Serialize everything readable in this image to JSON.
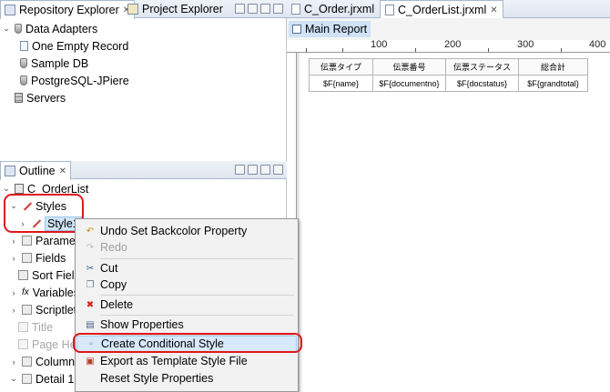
{
  "repository_panel": {
    "tab_repository": "Repository Explorer",
    "tab_project": "Project Explorer",
    "tree": [
      {
        "label": "Data Adapters",
        "level": 0,
        "expanded": true
      },
      {
        "label": "One Empty Record",
        "level": 1
      },
      {
        "label": "Sample DB",
        "level": 1
      },
      {
        "label": "PostgreSQL-JPiere",
        "level": 1
      },
      {
        "label": "Servers",
        "level": 0
      }
    ]
  },
  "outline_panel": {
    "tab_outline": "Outline",
    "root": "C_OrderList",
    "styles": "Styles",
    "style1": "Style1",
    "items": [
      "Parameters",
      "Fields",
      "Sort Fields",
      "Variables",
      "Scriptlets",
      "Title",
      "Page Header",
      "Column Header",
      "Detail 1"
    ]
  },
  "editor": {
    "tabs": [
      "C_Order.jrxml",
      "C_OrderList.jrxml"
    ],
    "active_tab": "C_OrderList.jrxml",
    "breadcrumb": "Main Report",
    "ruler_labels": [
      "100",
      "200",
      "300",
      "400"
    ],
    "table_headers": [
      "伝票タイプ",
      "伝票番号",
      "伝票ステータス",
      "総合計"
    ],
    "table_fields": [
      "$F{name}",
      "$F{documentno}",
      "$F{docstatus}",
      "$F{grandtotal}"
    ]
  },
  "context_menu": {
    "items": [
      {
        "label": "Undo Set Backcolor Property",
        "icon": "undo-icon",
        "enabled": true
      },
      {
        "label": "Redo",
        "icon": "redo-icon",
        "enabled": false
      },
      {
        "label": "Cut",
        "icon": "cut-icon",
        "enabled": true
      },
      {
        "label": "Copy",
        "icon": "copy-icon",
        "enabled": true
      },
      {
        "label": "Delete",
        "icon": "delete-icon",
        "enabled": true
      },
      {
        "label": "Show Properties",
        "icon": "properties-icon",
        "enabled": true
      },
      {
        "label": "Create Conditional Style",
        "icon": "conditional-style-icon",
        "enabled": true,
        "highlighted": true
      },
      {
        "label": "Export as Template Style File",
        "icon": "export-icon",
        "enabled": true
      },
      {
        "label": "Reset Style Properties",
        "icon": "",
        "enabled": true
      }
    ]
  },
  "colors": {
    "highlight_ring": "#e0161c",
    "menu_highlight": "#d7e9fb",
    "selection": "#cfe4f7"
  }
}
